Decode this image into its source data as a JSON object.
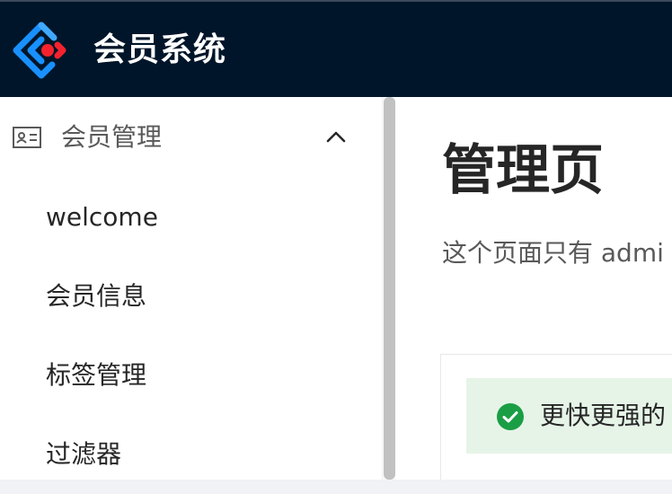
{
  "header": {
    "app_title": "会员系统",
    "logo_icon": "ant-design-logo-icon",
    "background_color": "#001529"
  },
  "sidebar": {
    "submenu": {
      "icon": "idcard-icon",
      "title": "会员管理",
      "expanded": true,
      "chevron_icon": "chevron-up-icon"
    },
    "items": [
      {
        "label": "welcome"
      },
      {
        "label": "会员信息"
      },
      {
        "label": "标签管理"
      },
      {
        "label": "过滤器"
      }
    ]
  },
  "main": {
    "title": "管理页",
    "description": "这个页面只有 admi",
    "alert": {
      "icon": "check-circle-icon",
      "text": "更快更强的",
      "color": "#1a9e45",
      "background": "#e6f4e8"
    }
  }
}
